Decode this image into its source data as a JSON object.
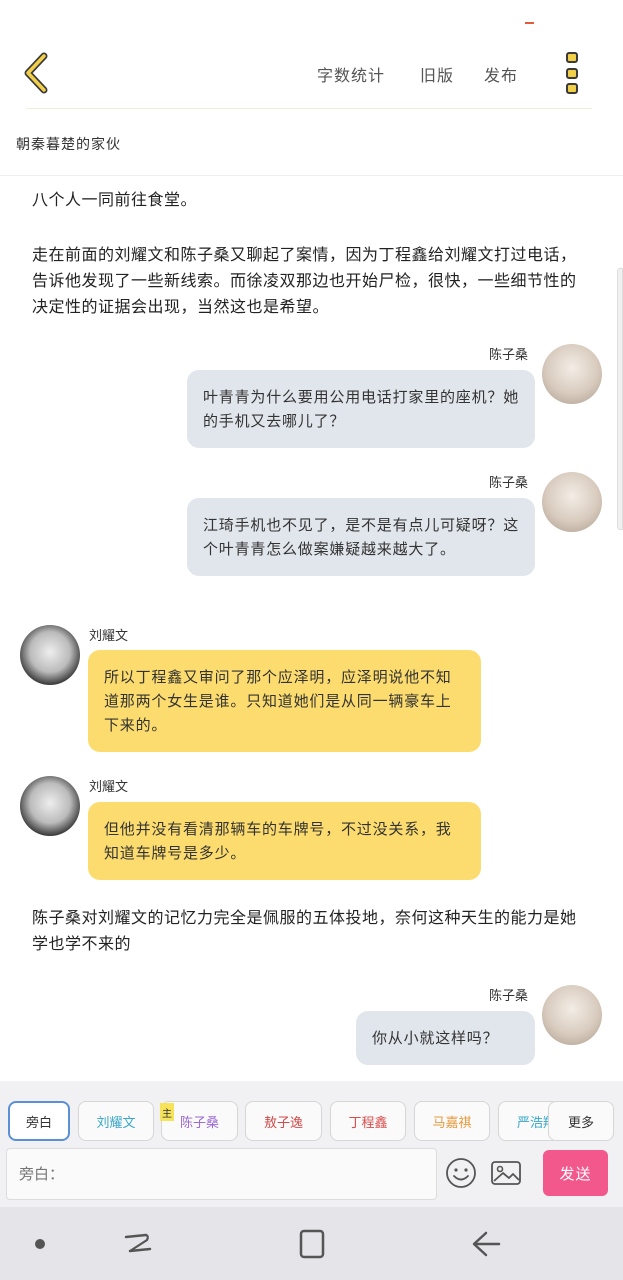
{
  "topbar": {
    "word_count": "字数统计",
    "old_version": "旧版",
    "publish": "发布"
  },
  "book_title": "朝秦暮楚的家伙",
  "content": {
    "narration_1": "八个人一同前往食堂。",
    "narration_2": "走在前面的刘耀文和陈子桑又聊起了案情，因为丁程鑫给刘耀文打过电话，告诉他发现了一些新线索。而徐凌双那边也开始尸检，很快，一些细节性的决定性的证据会出现，当然这也是希望。",
    "msg_1": {
      "speaker": "陈子桑",
      "text": "叶青青为什么要用公用电话打家里的座机？她的手机又去哪儿了？"
    },
    "msg_2": {
      "speaker": "陈子桑",
      "text": "江琦手机也不见了，是不是有点儿可疑呀？这个叶青青怎么做案嫌疑越来越大了。"
    },
    "msg_3": {
      "speaker": "刘耀文",
      "text": "所以丁程鑫又审问了那个应泽明，应泽明说他不知道那两个女生是谁。只知道她们是从同一辆豪车上下来的。"
    },
    "msg_4": {
      "speaker": "刘耀文",
      "text": "但他并没有看清那辆车的车牌号，不过没关系，我知道车牌号是多少。"
    },
    "narration_3": "陈子桑对刘耀文的记忆力完全是佩服的五体投地，奈何这种天生的能力是她学也学不来的",
    "msg_5": {
      "speaker": "陈子桑",
      "text": "你从小就这样吗？"
    }
  },
  "characters": {
    "narrator": "旁白",
    "c1": "刘耀文",
    "main_tag": "主",
    "c2": "陈子桑",
    "c3": "敖子逸",
    "c4": "丁程鑫",
    "c5": "马嘉祺",
    "c6": "严浩翔",
    "more": "更多"
  },
  "colors": {
    "accent_yellow": "#f2cf49",
    "bubble_left": "#fcdc6e",
    "bubble_right": "#e1e6ed",
    "send": "#f2588b",
    "chip_c1": "#3aa8c9",
    "chip_c2": "#9b6bd6",
    "chip_c3": "#d14b4b",
    "chip_c4": "#d94c4c",
    "chip_c5": "#e79a3b",
    "chip_c6": "#3aa8c9"
  },
  "input": {
    "placeholder": "旁白："
  },
  "send_label": "发送",
  "icons": {
    "back": "chevron-left-icon",
    "more": "more-vertical-icon",
    "emoji": "emoji-icon",
    "image": "image-icon"
  }
}
